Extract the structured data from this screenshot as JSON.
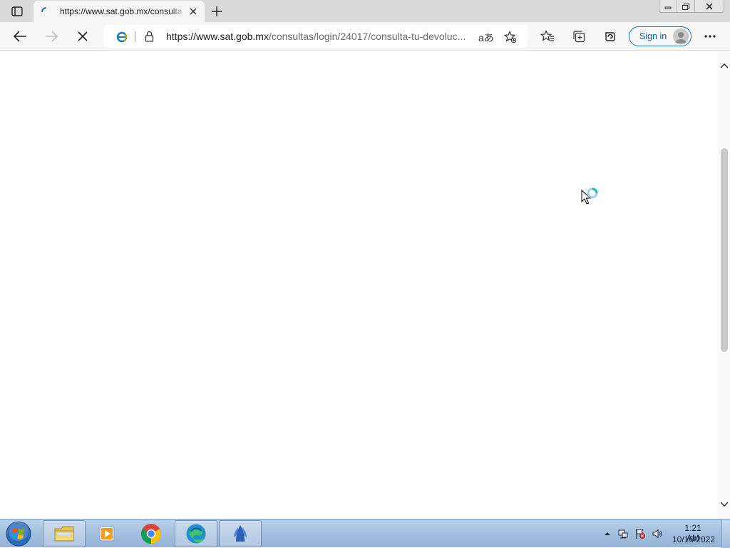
{
  "browser": {
    "tab": {
      "title": "https://www.sat.gob.mx/consulta"
    },
    "address": {
      "host": "https://www.sat.gob.mx",
      "path": "/consultas/login/24017/consulta-tu-devoluc...",
      "read_aloud_glyph": "aあ"
    },
    "signin_label": "Sign in"
  },
  "taskbar": {
    "apps": [
      "file-explorer",
      "media-player",
      "chrome",
      "edge",
      "app"
    ],
    "clock": {
      "time": "1:21 AM",
      "date": "10/16/2022"
    }
  },
  "colors": {
    "accent": "#0f5fa3",
    "taskbar": "#a6c1df",
    "tabstrip": "#dadada"
  }
}
